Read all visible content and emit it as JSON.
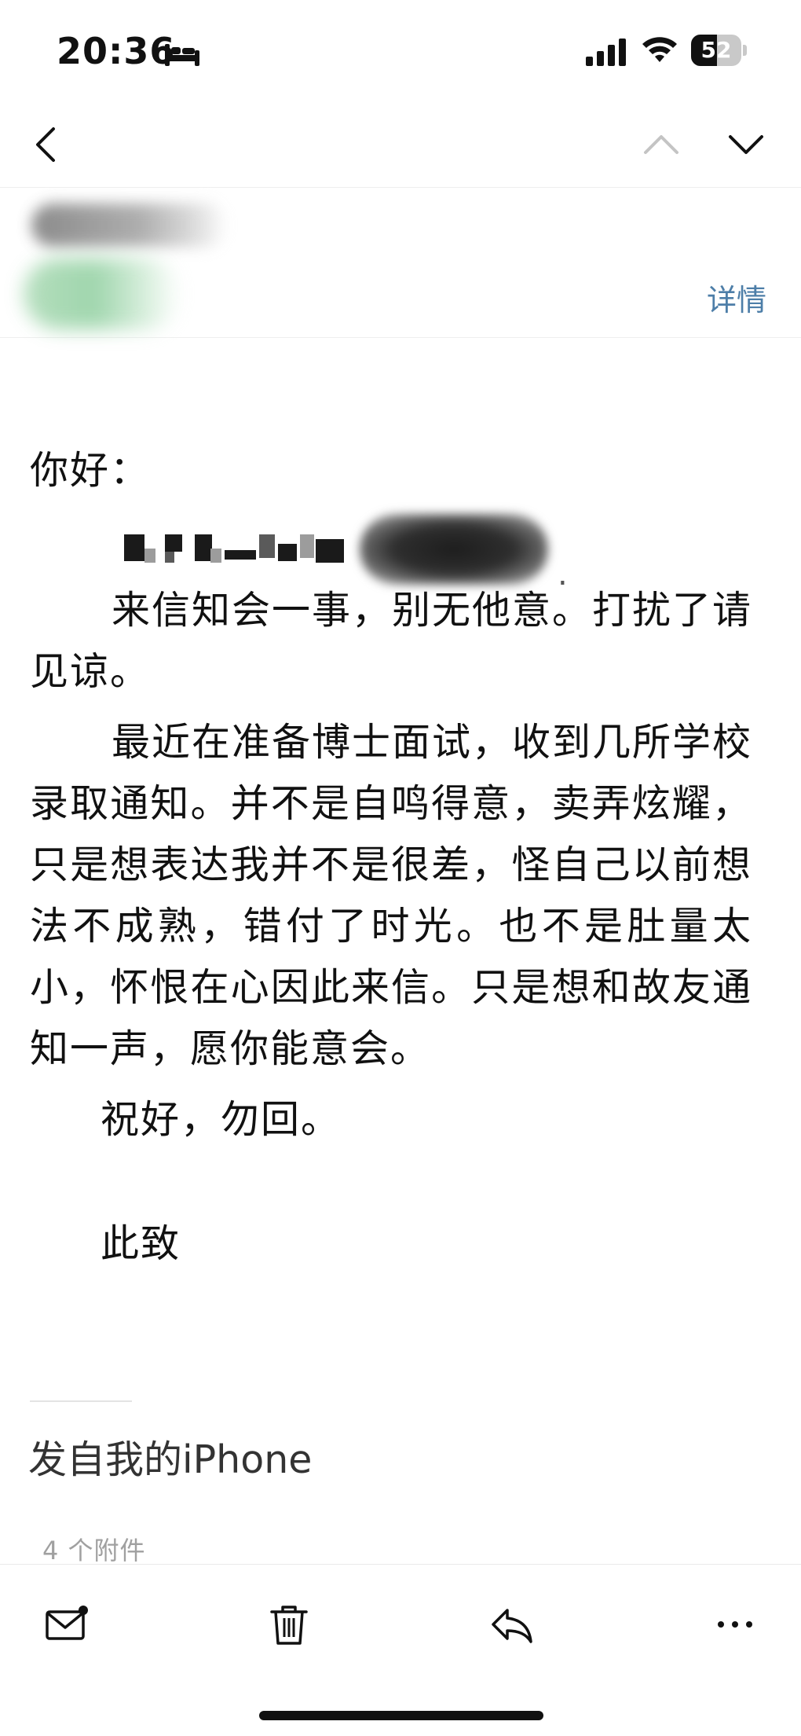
{
  "status_bar": {
    "time": "20:36",
    "battery_level": "52",
    "battery_fraction": 0.52,
    "focus_mode_icon": "bed-icon",
    "signal_icon": "cellular-signal-icon",
    "wifi_icon": "wifi-icon"
  },
  "nav": {
    "back_icon": "chevron-left-icon",
    "prev_icon": "chevron-up-icon",
    "next_icon": "chevron-down-icon"
  },
  "header": {
    "details_label": "详情"
  },
  "email": {
    "greeting": "你好：",
    "paragraphs": [
      "来信知会一事，别无他意。打扰了请见谅。",
      "最近在准备博士面试，收到几所学校录取通知。并不是自鸣得意，卖弄炫耀，只是想表达我并不是很差，怪自己以前想法不成熟，错付了时光。也不是肚量太小，怀恨在心因此来信。只是想和故友通知一声，愿你能意会。"
    ],
    "closing": "祝好，勿回。",
    "sign_off": "此致",
    "signature": "发自我的iPhone",
    "attachments_label": "4 个附件"
  },
  "toolbar": {
    "mail_icon": "mail-unread-icon",
    "trash_icon": "trash-icon",
    "reply_icon": "reply-icon",
    "more_icon": "more-icon"
  },
  "colors": {
    "accent": "#4d7ea8",
    "text": "#111111",
    "muted": "#a0a0a0"
  }
}
